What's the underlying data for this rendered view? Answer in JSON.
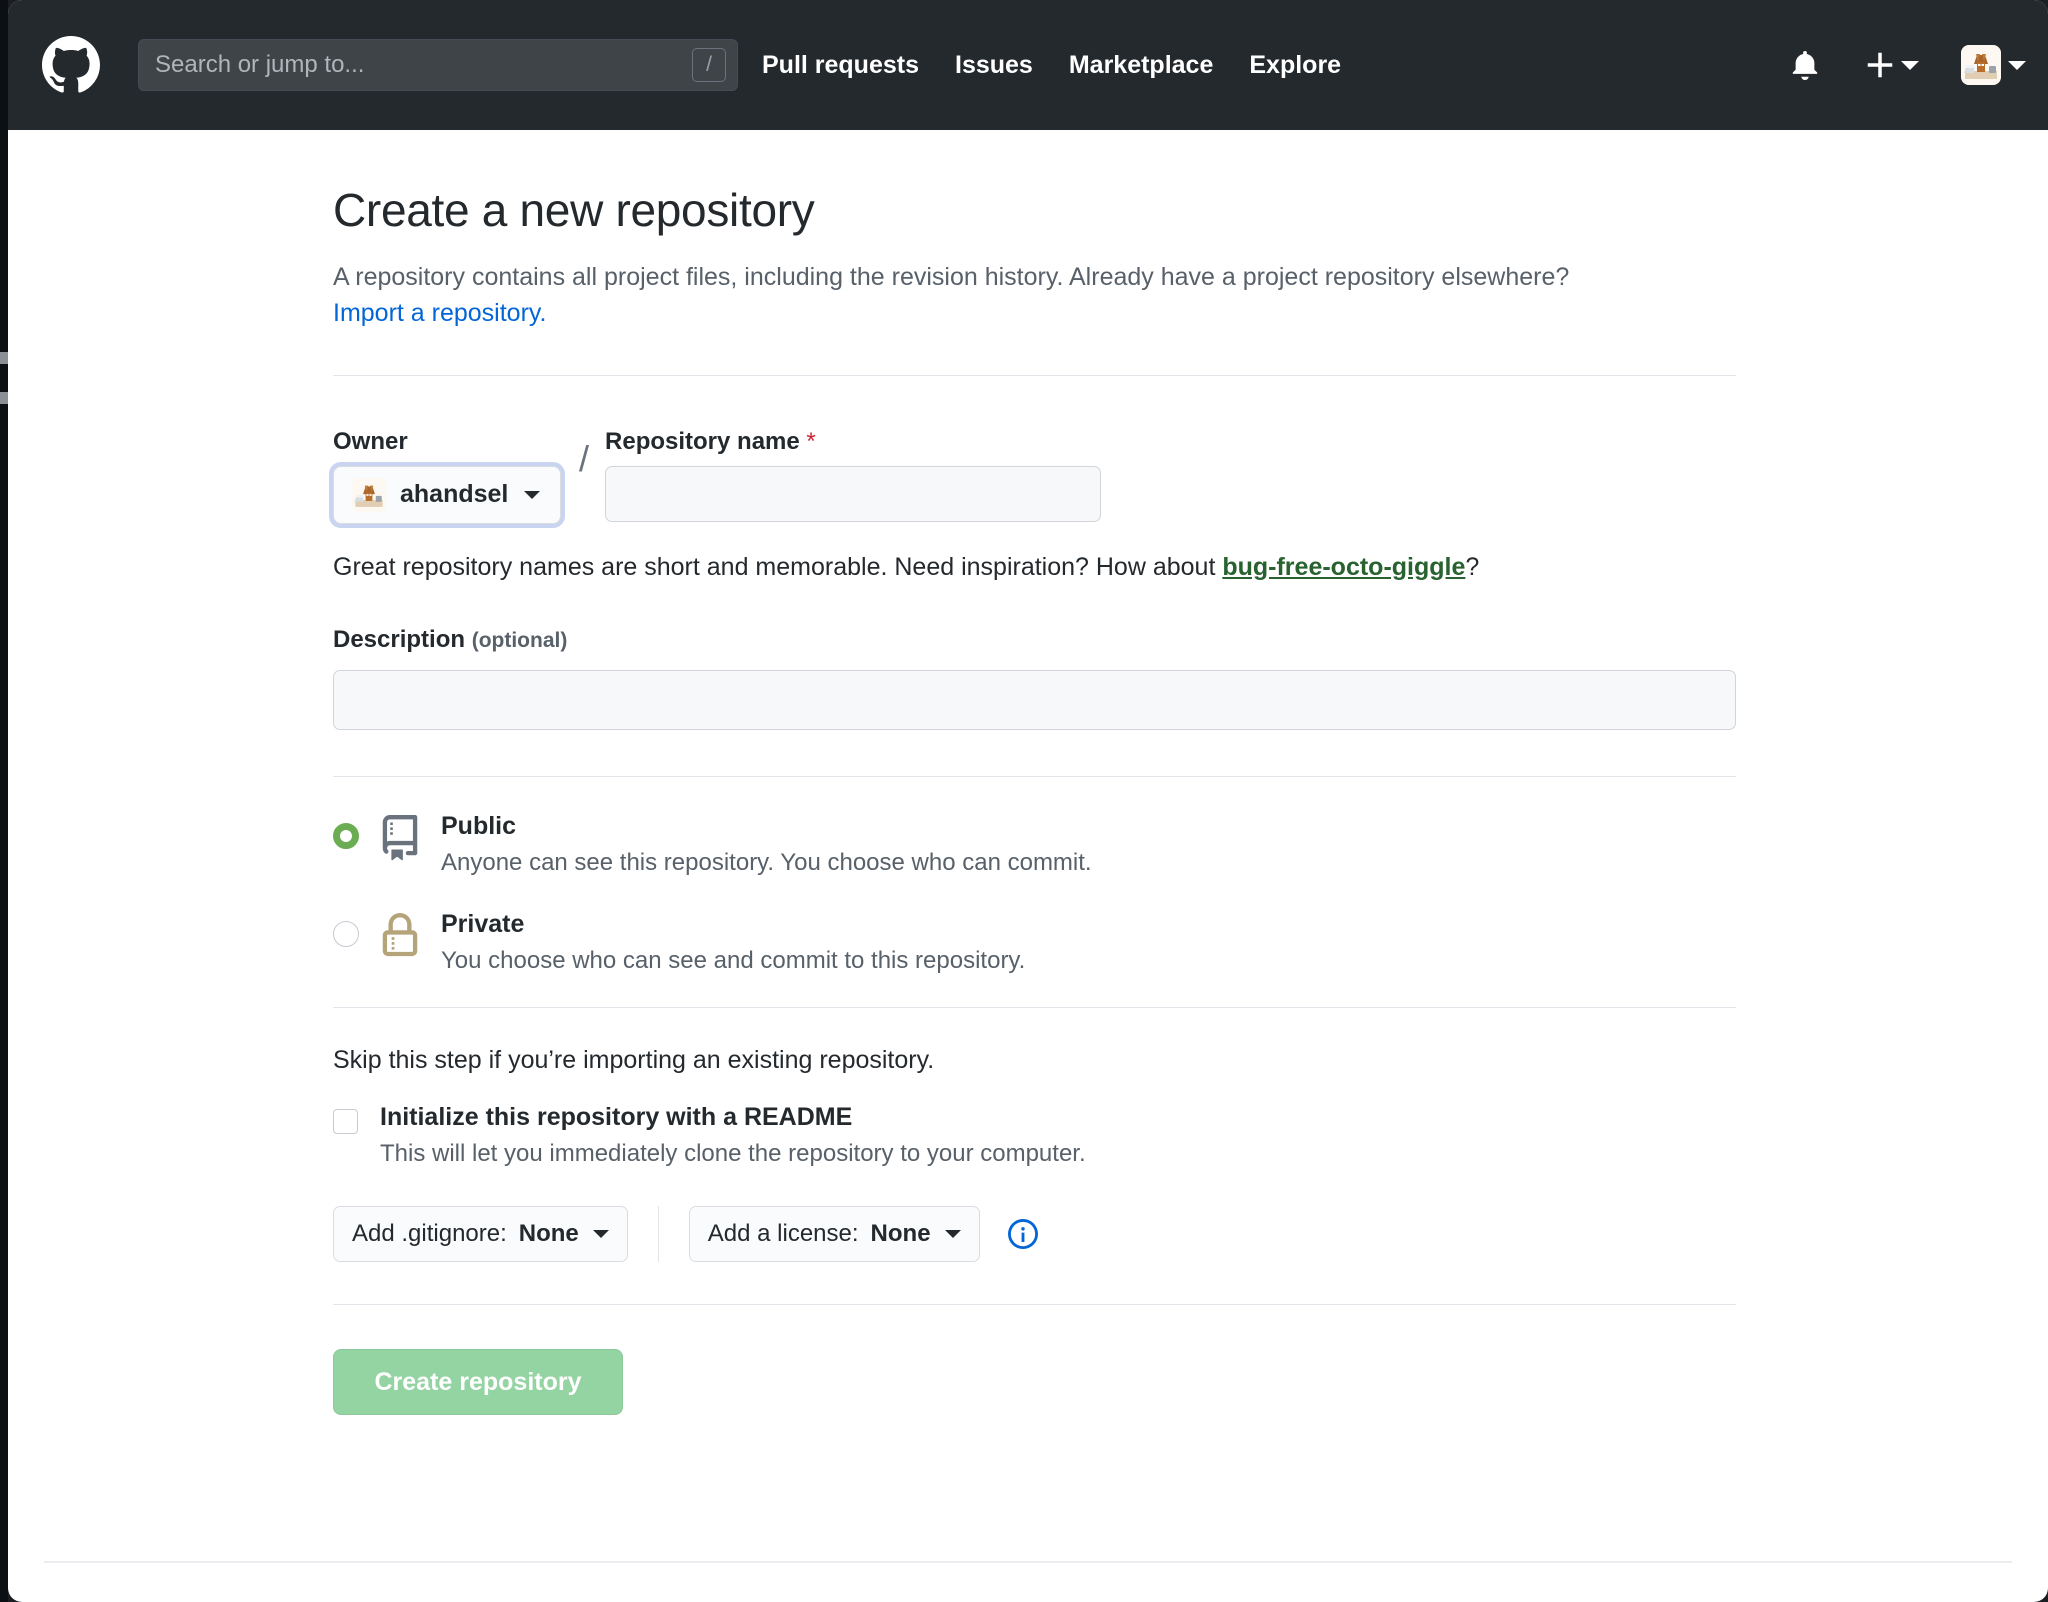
{
  "header": {
    "logo_icon": "github-mark-icon",
    "search": {
      "placeholder": "Search or jump to...",
      "value": "",
      "shortcut_key": "/"
    },
    "nav": [
      {
        "label": "Pull requests"
      },
      {
        "label": "Issues"
      },
      {
        "label": "Marketplace"
      },
      {
        "label": "Explore"
      }
    ],
    "notifications_icon": "bell-icon",
    "create_new_icon": "plus-icon",
    "account_avatar": "user-avatar",
    "background_color": "#24292e"
  },
  "page": {
    "title": "Create a new repository",
    "description_part1": "A repository contains all project files, including the revision history. Already have a project repository elsewhere? ",
    "import_link": "Import a repository."
  },
  "form": {
    "owner": {
      "label": "Owner",
      "selected": "ahandsel",
      "avatar_icon": "owner-avatar"
    },
    "separator": "/",
    "repo_name": {
      "label": "Repository name",
      "required_marker": "*",
      "value": "",
      "placeholder": ""
    },
    "hint_prefix": "Great repository names are short and memorable. Need inspiration? How about ",
    "hint_suggestion": "bug-free-octo-giggle",
    "hint_suffix": "?",
    "description": {
      "label": "Description",
      "optional_label": "(optional)",
      "value": "",
      "placeholder": ""
    },
    "visibility": {
      "options": [
        {
          "id": "public",
          "title": "Public",
          "subtitle": "Anyone can see this repository. You choose who can commit.",
          "icon": "repo-book-icon",
          "selected": true
        },
        {
          "id": "private",
          "title": "Private",
          "subtitle": "You choose who can see and commit to this repository.",
          "icon": "lock-icon",
          "selected": false
        }
      ],
      "selected_color": "#6cad54"
    },
    "skip_text": "Skip this step if you’re importing an existing repository.",
    "readme": {
      "label": "Initialize this repository with a README",
      "sublabel": "This will let you immediately clone the repository to your computer.",
      "checked": false
    },
    "gitignore_dropdown": {
      "prefix": "Add .gitignore: ",
      "value": "None"
    },
    "license_dropdown": {
      "prefix": "Add a license: ",
      "value": "None"
    },
    "info_icon": "info-icon",
    "submit": {
      "label": "Create repository",
      "color": "#94d3a2",
      "disabled": true
    }
  }
}
